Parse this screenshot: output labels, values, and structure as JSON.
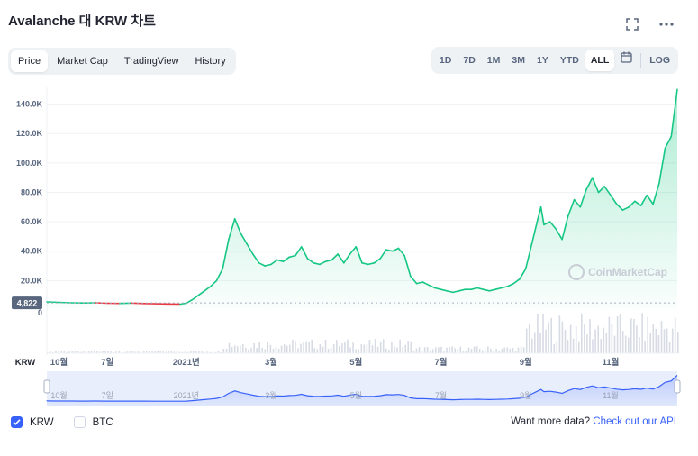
{
  "header": {
    "title": "Avalanche 대 KRW 차트"
  },
  "tabs": [
    {
      "label": "Price",
      "active": true
    },
    {
      "label": "Market Cap",
      "active": false
    },
    {
      "label": "TradingView",
      "active": false
    },
    {
      "label": "History",
      "active": false
    }
  ],
  "ranges": [
    {
      "label": "1D",
      "active": false
    },
    {
      "label": "7D",
      "active": false
    },
    {
      "label": "1M",
      "active": false
    },
    {
      "label": "3M",
      "active": false
    },
    {
      "label": "1Y",
      "active": false
    },
    {
      "label": "YTD",
      "active": false
    },
    {
      "label": "ALL",
      "active": true
    }
  ],
  "log_label": "LOG",
  "icons": {
    "expand": "fullscreen-icon",
    "more": "more-icon",
    "calendar": "calendar-icon",
    "check": "check-icon"
  },
  "colors": {
    "up": "#16c784",
    "down": "#ea3943",
    "accent": "#3861fb"
  },
  "chart_data": {
    "type": "line",
    "x_labels": [
      "10월",
      "7일",
      "2021년",
      "3월",
      "5월",
      "7월",
      "9월",
      "11월"
    ],
    "currency_label": "KRW",
    "y_ticks": [
      "20.0K",
      "40.0K",
      "60.0K",
      "80.0K",
      "100.0K",
      "120.0K",
      "140.0K"
    ],
    "ylim": [
      0,
      152000
    ],
    "current_price_label": "4,822",
    "zero_label": "0",
    "watermark": "CoinMarketCap",
    "x_domain": [
      0,
      100
    ],
    "x_tick_positions": [
      2,
      10,
      23,
      37,
      51,
      65,
      79,
      93
    ],
    "series": [
      {
        "values": [
          [
            0,
            5500
          ],
          [
            2,
            5200
          ],
          [
            4,
            4900
          ],
          [
            6,
            4800
          ],
          [
            8,
            4900
          ],
          [
            10,
            4600
          ],
          [
            12,
            4500
          ],
          [
            14,
            4700
          ],
          [
            16,
            4400
          ],
          [
            18,
            4200
          ],
          [
            20,
            4100
          ],
          [
            22,
            4000
          ],
          [
            23,
            4600
          ],
          [
            24,
            7000
          ],
          [
            25,
            10000
          ],
          [
            26,
            13000
          ],
          [
            27,
            16000
          ],
          [
            28,
            20000
          ],
          [
            29,
            28000
          ],
          [
            30,
            48000
          ],
          [
            31,
            62000
          ],
          [
            32,
            52000
          ],
          [
            33,
            45000
          ],
          [
            34,
            38000
          ],
          [
            35,
            32000
          ],
          [
            36,
            30000
          ],
          [
            37,
            31000
          ],
          [
            38,
            34000
          ],
          [
            39,
            33000
          ],
          [
            40,
            36000
          ],
          [
            41,
            37000
          ],
          [
            42,
            43000
          ],
          [
            43,
            35000
          ],
          [
            44,
            32000
          ],
          [
            45,
            31000
          ],
          [
            46,
            33000
          ],
          [
            47,
            34000
          ],
          [
            48,
            38000
          ],
          [
            49,
            32000
          ],
          [
            50,
            38000
          ],
          [
            51,
            43000
          ],
          [
            52,
            32000
          ],
          [
            53,
            31000
          ],
          [
            54,
            32000
          ],
          [
            55,
            35000
          ],
          [
            56,
            41000
          ],
          [
            57,
            40000
          ],
          [
            58,
            42000
          ],
          [
            59,
            37000
          ],
          [
            60,
            23000
          ],
          [
            61,
            18000
          ],
          [
            62,
            19000
          ],
          [
            63,
            17000
          ],
          [
            64,
            15000
          ],
          [
            65,
            14000
          ],
          [
            66,
            13000
          ],
          [
            67,
            12000
          ],
          [
            68,
            13000
          ],
          [
            69,
            14000
          ],
          [
            70,
            14000
          ],
          [
            71,
            15000
          ],
          [
            72,
            14000
          ],
          [
            73,
            13000
          ],
          [
            74,
            14000
          ],
          [
            75,
            15000
          ],
          [
            76,
            16000
          ],
          [
            77,
            18000
          ],
          [
            78,
            21000
          ],
          [
            79,
            28000
          ],
          [
            80,
            45000
          ],
          [
            81,
            62000
          ],
          [
            81.5,
            70000
          ],
          [
            82,
            58000
          ],
          [
            83,
            60000
          ],
          [
            84,
            55000
          ],
          [
            85,
            48000
          ],
          [
            86,
            64000
          ],
          [
            87,
            75000
          ],
          [
            88,
            70000
          ],
          [
            89,
            82000
          ],
          [
            90,
            90000
          ],
          [
            91,
            80000
          ],
          [
            92,
            84000
          ],
          [
            93,
            78000
          ],
          [
            94,
            72000
          ],
          [
            95,
            68000
          ],
          [
            96,
            70000
          ],
          [
            97,
            74000
          ],
          [
            98,
            71000
          ],
          [
            99,
            78000
          ],
          [
            100,
            72000
          ],
          [
            101,
            86000
          ],
          [
            102,
            110000
          ],
          [
            103,
            118000
          ],
          [
            104,
            150000
          ]
        ]
      }
    ]
  },
  "legend": [
    {
      "label": "KRW",
      "checked": true
    },
    {
      "label": "BTC",
      "checked": false
    }
  ],
  "footer": {
    "prompt": "Want more data?",
    "link": "Check out our API"
  }
}
